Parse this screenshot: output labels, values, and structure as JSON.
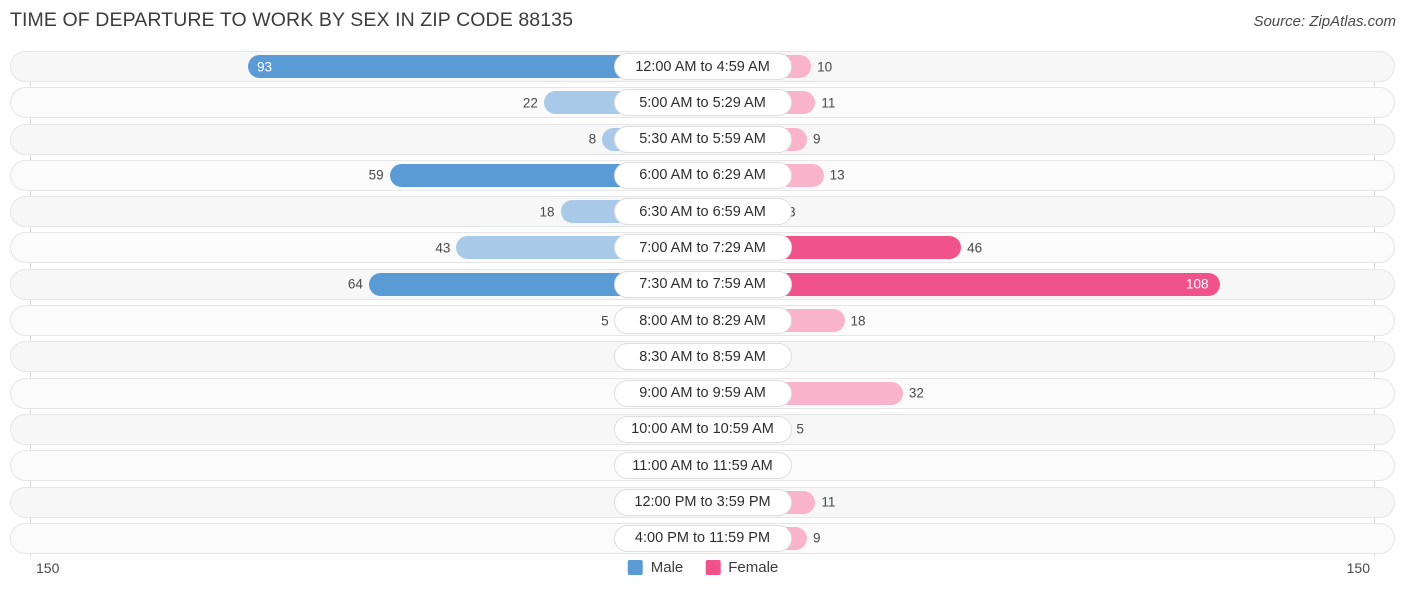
{
  "header": {
    "title": "TIME OF DEPARTURE TO WORK BY SEX IN ZIP CODE 88135",
    "source": "Source: ZipAtlas.com"
  },
  "axis": {
    "left_max": "150",
    "right_max": "150"
  },
  "legend": {
    "items": [
      {
        "label": "Male",
        "color": "#5b9bd5"
      },
      {
        "label": "Female",
        "color": "#f0538a"
      }
    ]
  },
  "colors": {
    "male_dark": "#5b9bd5",
    "male_light": "#a9c9e9",
    "female_dark": "#f0538a",
    "female_light": "#f9b4cb",
    "row_bg": "#f7f7f7",
    "row_border": "#e6e6e6",
    "grid": "#d8d8d8",
    "text": "#4a4a4a"
  },
  "chart_data": {
    "type": "bar",
    "title": "TIME OF DEPARTURE TO WORK BY SEX IN ZIP CODE 88135",
    "subtitle": "",
    "orientation": "horizontal-diverging",
    "xlabel": "",
    "ylabel": "",
    "xlim": [
      -150,
      150
    ],
    "axis_max": 150,
    "grid": false,
    "legend_position": "bottom-center",
    "categories": [
      "12:00 AM to 4:59 AM",
      "5:00 AM to 5:29 AM",
      "5:30 AM to 5:59 AM",
      "6:00 AM to 6:29 AM",
      "6:30 AM to 6:59 AM",
      "7:00 AM to 7:29 AM",
      "7:30 AM to 7:59 AM",
      "8:00 AM to 8:29 AM",
      "8:30 AM to 8:59 AM",
      "9:00 AM to 9:59 AM",
      "10:00 AM to 10:59 AM",
      "11:00 AM to 11:59 AM",
      "12:00 PM to 3:59 PM",
      "4:00 PM to 11:59 PM"
    ],
    "series": [
      {
        "name": "Male",
        "values": [
          93,
          22,
          8,
          59,
          18,
          43,
          64,
          5,
          0,
          0,
          0,
          0,
          0,
          2
        ]
      },
      {
        "name": "Female",
        "values": [
          10,
          11,
          9,
          13,
          3,
          46,
          108,
          18,
          0,
          32,
          5,
          0,
          11,
          9
        ]
      }
    ]
  },
  "rows": [
    {
      "label": "12:00 AM to 4:59 AM",
      "male": "93",
      "female": "10"
    },
    {
      "label": "5:00 AM to 5:29 AM",
      "male": "22",
      "female": "11"
    },
    {
      "label": "5:30 AM to 5:59 AM",
      "male": "8",
      "female": "9"
    },
    {
      "label": "6:00 AM to 6:29 AM",
      "male": "59",
      "female": "13"
    },
    {
      "label": "6:30 AM to 6:59 AM",
      "male": "18",
      "female": "3"
    },
    {
      "label": "7:00 AM to 7:29 AM",
      "male": "43",
      "female": "46"
    },
    {
      "label": "7:30 AM to 7:59 AM",
      "male": "64",
      "female": "108"
    },
    {
      "label": "8:00 AM to 8:29 AM",
      "male": "5",
      "female": "18"
    },
    {
      "label": "8:30 AM to 8:59 AM",
      "male": "0",
      "female": "0"
    },
    {
      "label": "9:00 AM to 9:59 AM",
      "male": "0",
      "female": "32"
    },
    {
      "label": "10:00 AM to 10:59 AM",
      "male": "0",
      "female": "5"
    },
    {
      "label": "11:00 AM to 11:59 AM",
      "male": "0",
      "female": "0"
    },
    {
      "label": "12:00 PM to 3:59 PM",
      "male": "0",
      "female": "11"
    },
    {
      "label": "4:00 PM to 11:59 PM",
      "male": "2",
      "female": "9"
    }
  ]
}
